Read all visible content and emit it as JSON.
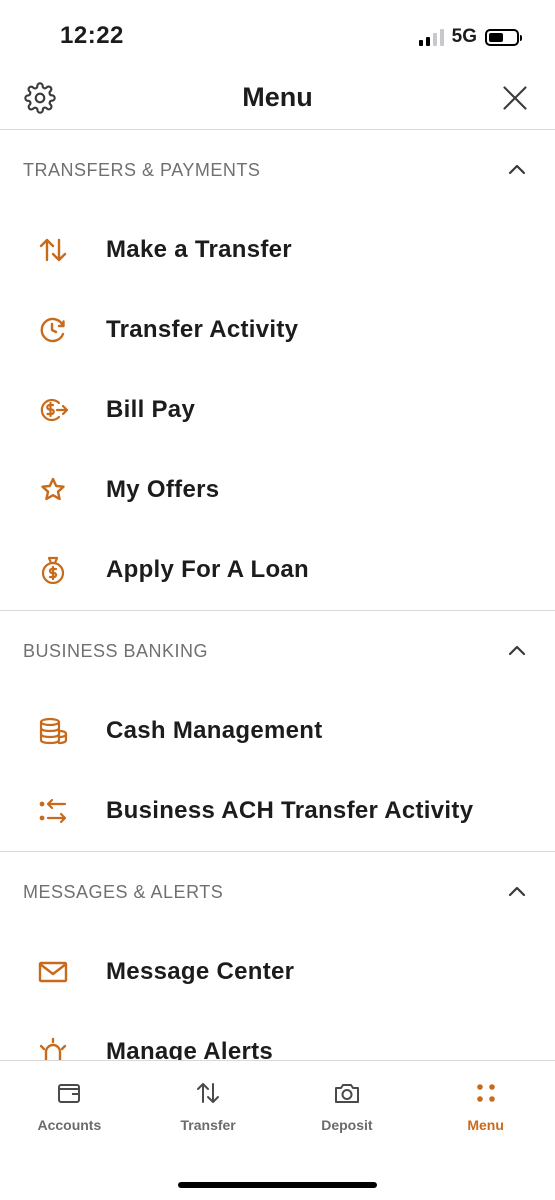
{
  "status": {
    "time": "12:22",
    "network": "5G"
  },
  "header": {
    "title": "Menu"
  },
  "colors": {
    "accent": "#c96a1b",
    "section_text": "#707070",
    "divider": "#d9d9d9"
  },
  "sections": [
    {
      "title": "TRANSFERS & PAYMENTS",
      "items": [
        {
          "label": "Make a Transfer",
          "icon": "transfer-arrows-icon"
        },
        {
          "label": "Transfer Activity",
          "icon": "clock-refresh-icon"
        },
        {
          "label": "Bill Pay",
          "icon": "bill-pay-icon"
        },
        {
          "label": "My Offers",
          "icon": "star-icon"
        },
        {
          "label": "Apply For A Loan",
          "icon": "money-bag-icon"
        }
      ]
    },
    {
      "title": "BUSINESS BANKING",
      "items": [
        {
          "label": "Cash Management",
          "icon": "coin-stack-icon"
        },
        {
          "label": "Business ACH Transfer Activity",
          "icon": "ach-transfer-icon"
        }
      ]
    },
    {
      "title": "MESSAGES & ALERTS",
      "items": [
        {
          "label": "Message Center",
          "icon": "envelope-icon"
        },
        {
          "label": "Manage Alerts",
          "icon": "alarm-icon"
        }
      ]
    }
  ],
  "tabbar": {
    "tabs": [
      {
        "label": "Accounts",
        "icon": "wallet-icon"
      },
      {
        "label": "Transfer",
        "icon": "transfer-arrows-icon"
      },
      {
        "label": "Deposit",
        "icon": "camera-icon"
      },
      {
        "label": "Menu",
        "icon": "menu-dots-icon",
        "active": true
      }
    ]
  }
}
